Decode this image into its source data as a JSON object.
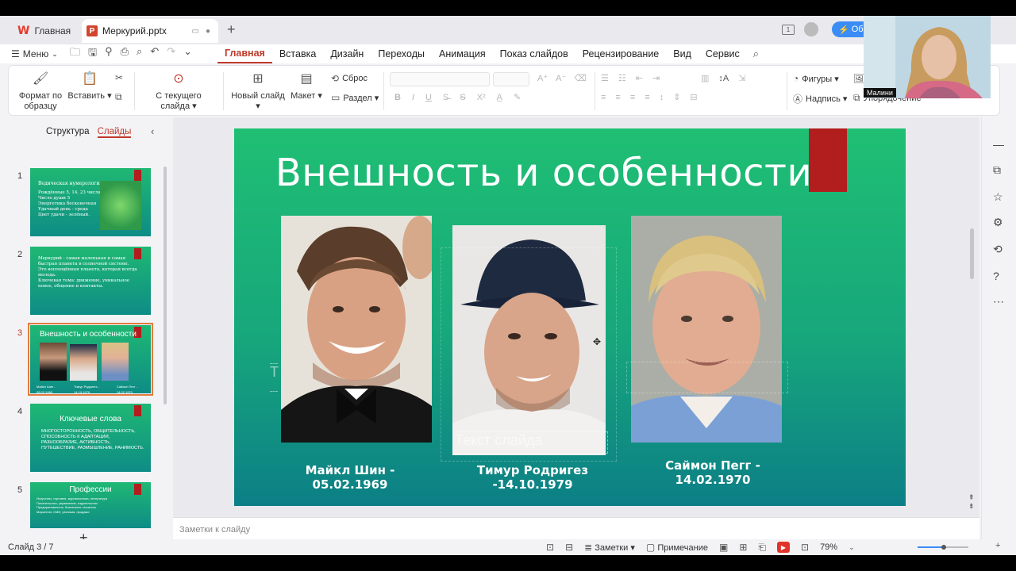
{
  "tabs": {
    "app_label": "Главная",
    "doc_label": "Меркурий.pptx",
    "upgrade_label": "Об"
  },
  "menubar": {
    "menu_label": "Меню",
    "ribbon_tabs": [
      "Главная",
      "Вставка",
      "Дизайн",
      "Переходы",
      "Анимация",
      "Показ слайдов",
      "Рецензирование",
      "Вид",
      "Сервис"
    ]
  },
  "ribbon": {
    "format_painter": "Формат по образцу",
    "paste": "Вставить",
    "from_current": "С текущего слайда",
    "new_slide": "Новый слайд",
    "layout": "Макет",
    "reset": "Сброс",
    "section": "Раздел",
    "shapes": "Фигуры",
    "textbox": "Надпись",
    "arrange": "Упорядочение"
  },
  "leftpane": {
    "tab_outline": "Структура",
    "tab_slides": "Слайды",
    "thumbs": [
      {
        "num": "1",
        "title": "Ведическая нумерология",
        "lines": [
          "Рождённые 5, 14, 23 числа",
          "Число души 5",
          "Энергетика бесконечная",
          "Удачный день - среда",
          "Цвет удачи - зелёный."
        ]
      },
      {
        "num": "2",
        "lines": [
          "Меркурий - самая маленькая и самая",
          "быстрая планета в солнечной системе.",
          "",
          "Это воплощённая планета, которая всегда",
          "молода.",
          "",
          "Ключевая тема: движение, уникальное",
          "новое, общение и контакты."
        ]
      },
      {
        "num": "3",
        "title": "Внешность и особенности",
        "caps": [
          "Майкл Шин - 05.02.1969",
          "Тимур Родригез - 14.10.1979",
          "Саймон Пегг - 14.02.1970"
        ]
      },
      {
        "num": "4",
        "title": "Ключевые слова",
        "lines": [
          "МНОГОСТОРОННОСТЬ, ОБЩИТЕЛЬНОСТЬ,",
          "СПОСОБНОСТЬ К АДАПТАЦИИ,",
          "РАЗНООБРАЗИЕ, АКТИВНОСТЬ,",
          "ПУТЕШЕСТВИЕ, РАЗМЫШЛЕНИЕ, РАНИМОСТЬ."
        ]
      },
      {
        "num": "5",
        "title": "Профессии",
        "lines": [
          "Искусство, торговля, журналистика, литература",
          "Писательство, управление, издательство",
          "Предприниматель, бизнесмен, писатель",
          "Маркетинг, СМИ, реклама, продажи"
        ]
      }
    ]
  },
  "slide": {
    "title": "Внешность и особенности",
    "captions": [
      "Майкл Шин - 05.02.1969",
      "Тимур Родригез -14.10.1979",
      "Саймон Пегг - 14.02.1970"
    ],
    "placeholder": "Текст слайда",
    "placeholder_left": "Т"
  },
  "notes_placeholder": "Заметки к слайду",
  "status": {
    "slide_counter": "Слайд 3 / 7",
    "notes_label": "Заметки",
    "comment_label": "Примечание",
    "zoom": "79%"
  },
  "webcam": {
    "name": "Малини"
  },
  "colors": {
    "accent": "#c0392b",
    "slide_green": "#1fbf73",
    "slide_teal": "#0c7f86",
    "slide_red": "#b21d1d"
  }
}
